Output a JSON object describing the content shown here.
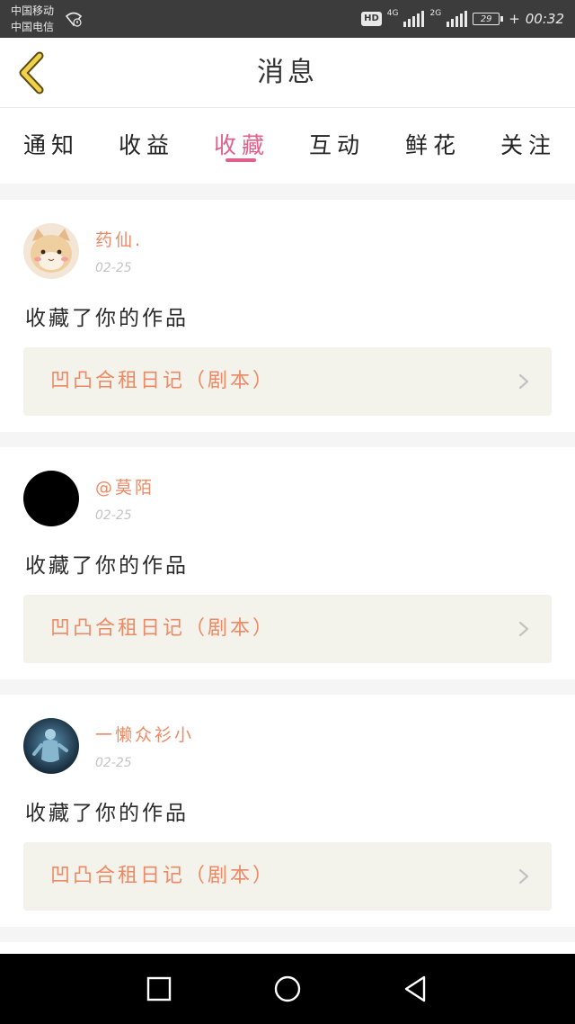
{
  "status_bar": {
    "carrier_1": "中国移动",
    "carrier_2": "中国电信",
    "hd": "HD",
    "net_1": "4G",
    "net_2": "2G",
    "battery": "29",
    "time": "00:32"
  },
  "header": {
    "back_icon": "chevron-left-icon",
    "title": "消息"
  },
  "tabs": [
    {
      "label": "通知",
      "active": false
    },
    {
      "label": "收益",
      "active": false
    },
    {
      "label": "收藏",
      "active": true
    },
    {
      "label": "互动",
      "active": false
    },
    {
      "label": "鲜花",
      "active": false
    },
    {
      "label": "关注",
      "active": false
    }
  ],
  "messages": [
    {
      "username": "药仙.",
      "date": "02-25",
      "action": "收藏了你的作品",
      "work": "凹凸合租日记（剧本）",
      "avatar": "cat-avatar"
    },
    {
      "username": "@莫陌",
      "date": "02-25",
      "action": "收藏了你的作品",
      "work": "凹凸合租日记（剧本）",
      "avatar": "black-avatar"
    },
    {
      "username": "一懒众衫小",
      "date": "02-25",
      "action": "收藏了你的作品",
      "work": "凹凸合租日记（剧本）",
      "avatar": "figure-avatar"
    }
  ],
  "colors": {
    "accent": "#e0608a",
    "username": "#ec8a66",
    "work_title": "#ec8a66",
    "background": "#f5f5f5"
  },
  "navbar": {
    "icons": [
      "square-recents-icon",
      "circle-home-icon",
      "triangle-back-icon"
    ]
  }
}
